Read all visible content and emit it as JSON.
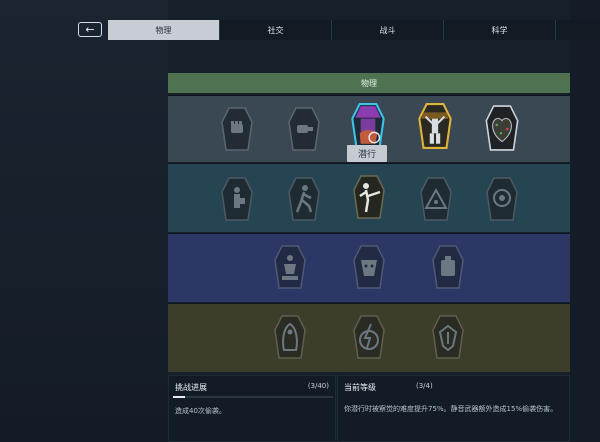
{
  "nav": {
    "back_label": "←",
    "tabs": [
      {
        "label": "物理",
        "active": true
      },
      {
        "label": "社交",
        "active": false
      },
      {
        "label": "战斗",
        "active": false
      },
      {
        "label": "科学",
        "active": false
      },
      {
        "label": "",
        "active": false
      }
    ]
  },
  "panel": {
    "title": "物理",
    "tooltip": "潜行"
  },
  "skills": {
    "tier1": [
      "fist-icon",
      "punch-icon",
      "stealth-icon",
      "strength-icon",
      "heart-icon"
    ],
    "tier2": [
      "thief-icon",
      "runner-icon",
      "kick-icon",
      "camp-icon",
      "vision-icon"
    ],
    "tier3": [
      "statue-icon",
      "mask-icon",
      "armor-icon"
    ],
    "tier4": [
      "cloak-icon",
      "lightning-icon",
      "shield-icon"
    ]
  },
  "challenge": {
    "title": "挑战进展",
    "count": "(3/40)",
    "progress": 0.075,
    "description": "造成40次偷袭。"
  },
  "current_level": {
    "title": "当前等级",
    "count": "(3/4)",
    "description": "你潜行时被察觉的难度提升75%。静音武器额外造成15%偷袭伤害。"
  },
  "colors": {
    "stealth_purple": "#8a3cb0",
    "stealth_border": "#39c3e6",
    "strength_gold": "#e0b43a",
    "header_green": "#4f7350"
  }
}
